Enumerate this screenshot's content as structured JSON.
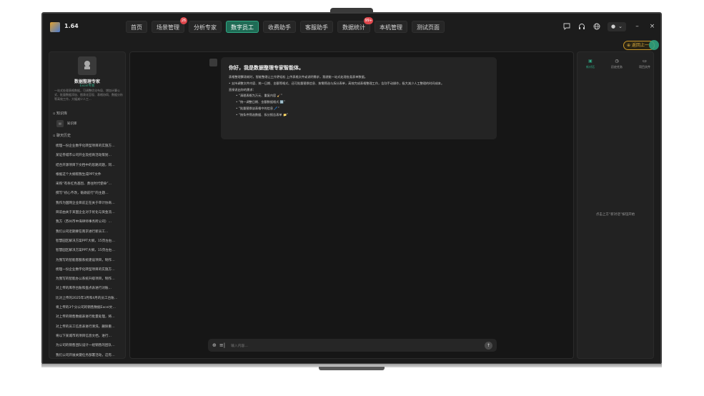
{
  "app": {
    "version": "1.64"
  },
  "nav": [
    {
      "label": "首页",
      "badge": "",
      "active": false
    },
    {
      "label": "场景管理",
      "badge": "26",
      "active": false
    },
    {
      "label": "分析专家",
      "badge": "",
      "active": false
    },
    {
      "label": "数字员工",
      "badge": "",
      "active": true
    },
    {
      "label": "收费助手",
      "badge": "",
      "active": false
    },
    {
      "label": "客服助手",
      "badge": "",
      "active": false
    },
    {
      "label": "数据统计",
      "badge": "99+",
      "active": false
    },
    {
      "label": "本机管理",
      "badge": "",
      "active": false
    },
    {
      "label": "测试页面",
      "badge": "",
      "active": false
    }
  ],
  "topbar_icons": [
    "message-icon",
    "headset-icon",
    "globe-icon",
    "user-icon",
    "minimize-icon",
    "close-icon"
  ],
  "sidebar": {
    "bot_name": "数据整理专家",
    "bot_tag": "Excel专家",
    "bot_desc": "一站式处理表格数据，可调整优化布局、增加计算公式、批量数据添加、图表化呈现、表格协同、数据分析等高效工作，大幅减少人工...",
    "knowledge_label": "知识库",
    "knowledge_item": "知识库",
    "history_label": "聊天历史",
    "history": [
      "梳理一份企业数字化转型项目的实施方…",
      "某证券城市公司开业及招商活动策划…",
      "结合开源项目下文档中的思路问题，同…",
      "根据这个大纲帮我生成PPT文件",
      "采购“有条红色基因、勇往时代使命”…",
      "撰写“初心不改，砥砺前行”的主题…",
      "我作为国网企业目前正在关于审计协商…",
      "目前由关于某国企业对于优化与资金流…",
      "我方（苏州市中海律师事务所公司）…",
      "我们公司近期要在南京进行新员工…",
      "智慧园区解决方案PPT大纲，15页左右…",
      "智慧园区解决方案PPT大纲，15页左右…",
      "为我写的智能客服系统建设项目，制作…",
      "梳理一份企业数字化转型项目的实施方…",
      "为我写的智能办公系统升级项目，制作…",
      "对上传的库存台账和盘点表进行对账…",
      "比对上传的2025年3月和4月的员工台账…",
      "将上传的3个分公司的销售数据Excel文…",
      "对上传的销售数据表进行批量处理，将…",
      "对上传的员工信息表进行清洗，删除重…",
      "将以下某城市的项目信息文档，进行…",
      "为公司的销售团队设计一组销售的团队…",
      "我们公司开展关键任务部署活动，这有…"
    ]
  },
  "chat": {
    "title": "你好，我是数据整理专家智能体。",
    "intro": "表格整理繁琐耗时，智能整理让工作更轻松 上传表格文件或说明需求，我就能一站式处理各类表单数据。",
    "bullet": "支持调整文件内容、统一日期、金额等格式、还可批量替换信息、按需筛选与拆分表单，高效完成表格整理工作，告别手动操作，极大减少人工整理的时间成本。",
    "examples_label": "直接说出你的需求：",
    "examples": [
      "清理表格为万元、重复内容 🧹",
      "统一调整日期、金额数据格式 🔢",
      "批量替换该表格中的信息 🖊️",
      "按条件筛选数据、拆分报告表单 📁"
    ],
    "input_placeholder": "输入内容...",
    "input_mode": "≡|"
  },
  "right_panel": {
    "tabs": [
      {
        "label": "新对话",
        "icon": "chat-add-icon",
        "active": true
      },
      {
        "label": "历史任务",
        "icon": "clock-icon",
        "active": false
      },
      {
        "label": "项目文件",
        "icon": "folder-icon",
        "active": false
      }
    ],
    "empty_text": "点击上方“新对话”按钮开始"
  },
  "back_button": "返回上一"
}
